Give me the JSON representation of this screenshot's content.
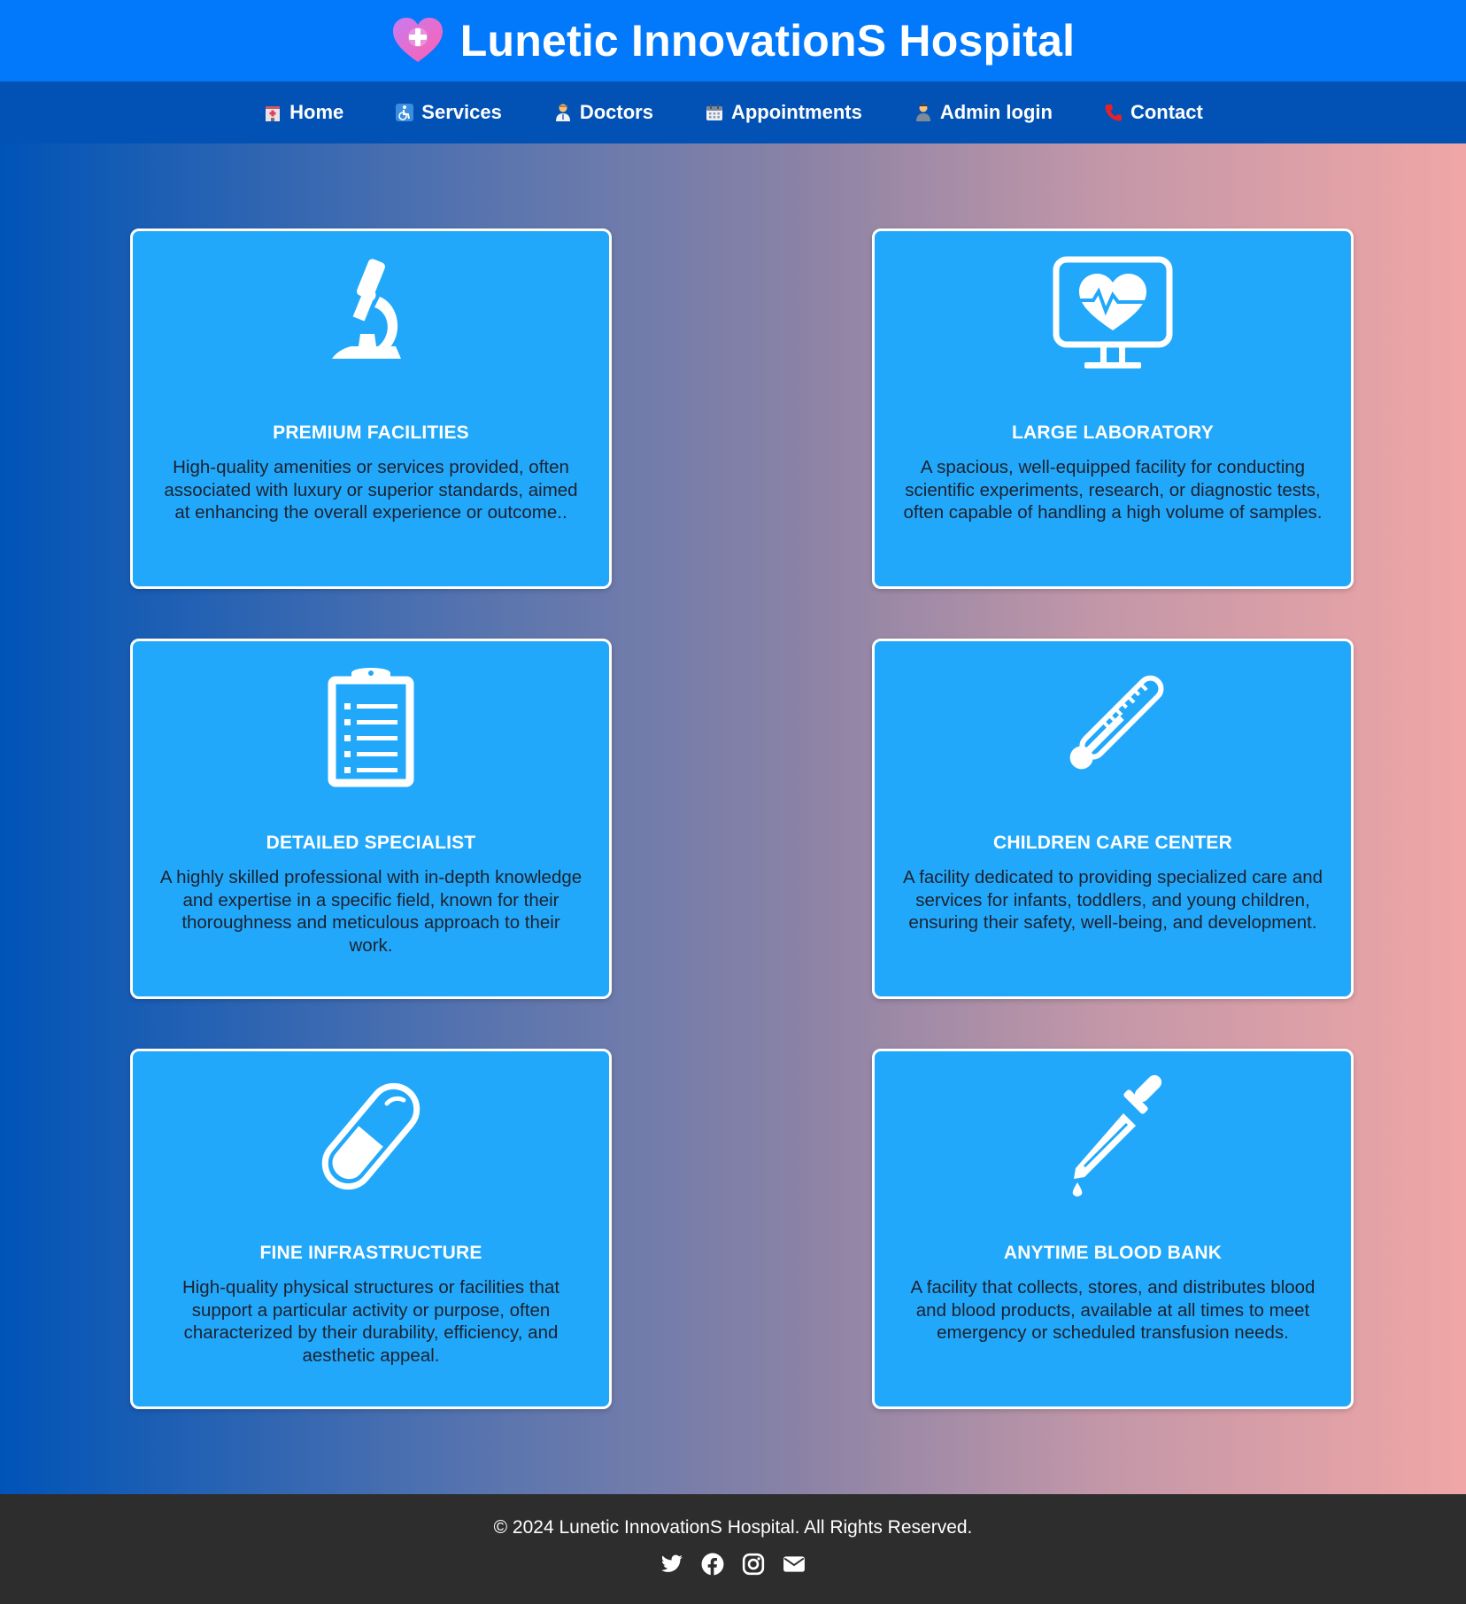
{
  "header": {
    "title": "Lunetic InnovationS Hospital",
    "logo_icon": "heart-plus-icon"
  },
  "nav": {
    "items": [
      {
        "label": "Home",
        "icon": "hospital-icon"
      },
      {
        "label": "Services",
        "icon": "wheelchair-icon"
      },
      {
        "label": "Doctors",
        "icon": "doctor-icon"
      },
      {
        "label": "Appointments",
        "icon": "calendar-icon"
      },
      {
        "label": "Admin login",
        "icon": "admin-icon"
      },
      {
        "label": "Contact",
        "icon": "phone-icon"
      }
    ]
  },
  "cards": [
    {
      "title": "PREMIUM FACILITIES",
      "icon": "microscope-icon",
      "text": "High-quality amenities or services provided, often associated with luxury or superior standards, aimed at enhancing the overall experience or outcome.."
    },
    {
      "title": "LARGE LABORATORY",
      "icon": "heart-monitor-icon",
      "text": "A spacious, well-equipped facility for conducting scientific experiments, research, or diagnostic tests, often capable of handling a high volume of samples."
    },
    {
      "title": "DETAILED SPECIALIST",
      "icon": "clipboard-icon",
      "text": "A highly skilled professional with in-depth knowledge and expertise in a specific field, known for their thoroughness and meticulous approach to their work."
    },
    {
      "title": "CHILDREN CARE CENTER",
      "icon": "thermometer-icon",
      "text": "A facility dedicated to providing specialized care and services for infants, toddlers, and young children, ensuring their safety, well-being, and development."
    },
    {
      "title": "FINE INFRASTRUCTURE",
      "icon": "capsule-icon",
      "text": "High-quality physical structures or facilities that support a particular activity or purpose, often characterized by their durability, efficiency, and aesthetic appeal."
    },
    {
      "title": "ANYTIME BLOOD BANK",
      "icon": "dropper-icon",
      "text": "A facility that collects, stores, and distributes blood and blood products, available at all times to meet emergency or scheduled transfusion needs."
    }
  ],
  "footer": {
    "copyright": "© 2024 Lunetic InnovationS Hospital. All Rights Reserved.",
    "social": [
      "twitter-icon",
      "facebook-icon",
      "instagram-icon",
      "email-icon"
    ]
  },
  "colors": {
    "header_bg": "#0279fa",
    "nav_bg": "#0252b5",
    "card_bg": "#22a8fa",
    "footer_bg": "#2d2d2d",
    "gradient_start": "#0053b8",
    "gradient_end": "#f0a6a6"
  }
}
